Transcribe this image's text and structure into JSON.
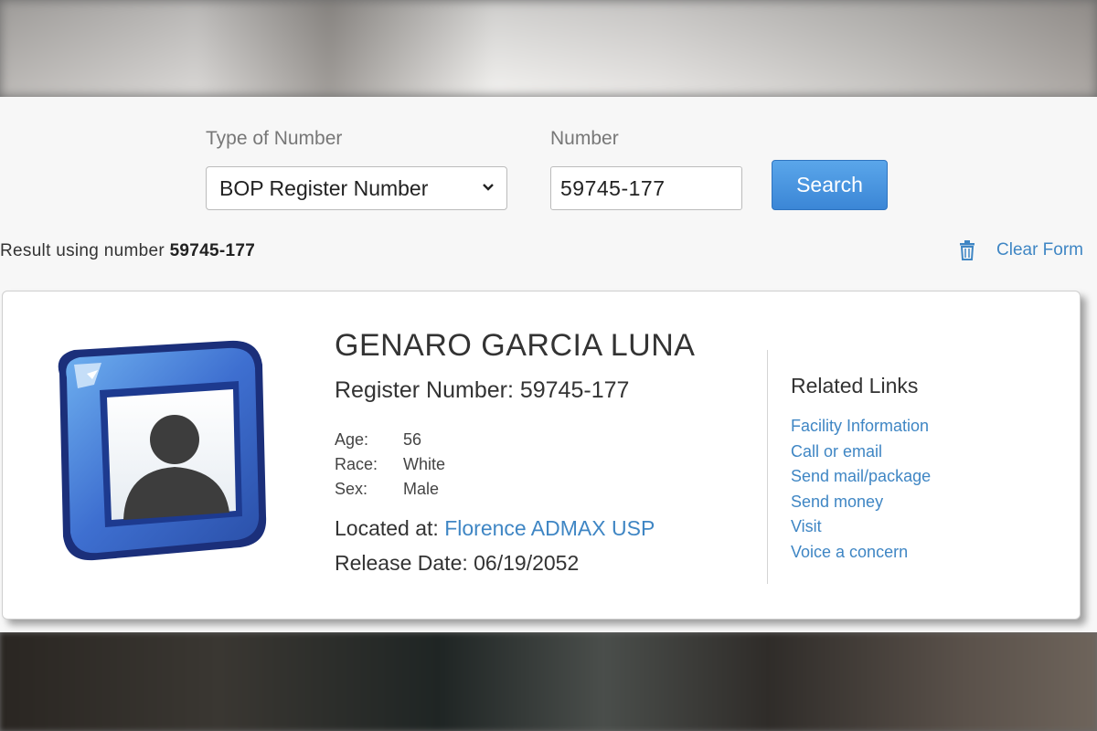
{
  "search": {
    "type_label": "Type of Number",
    "type_value": "BOP Register Number",
    "number_label": "Number",
    "number_value": "59745-177",
    "search_button": "Search"
  },
  "result": {
    "prefix": "Result using number",
    "number": "59745-177",
    "clear_form": "Clear Form"
  },
  "inmate": {
    "name": "GENARO GARCIA LUNA",
    "register_number": "Register Number: 59745-177",
    "attributes": [
      {
        "label": "Age:",
        "value": "56"
      },
      {
        "label": "Race:",
        "value": "White"
      },
      {
        "label": "Sex:",
        "value": "Male"
      }
    ],
    "located_label": "Located at:",
    "facility": "Florence ADMAX USP",
    "release_date": "Release Date: 06/19/2052"
  },
  "related_links": {
    "title": "Related Links",
    "links": [
      "Facility Information",
      "Call or email",
      "Send mail/package",
      "Send money",
      "Visit",
      "Voice a concern"
    ]
  },
  "colors": {
    "link": "#3f86c4",
    "button": "#4a95e0",
    "avatar_frame": "#3e6fd0"
  }
}
